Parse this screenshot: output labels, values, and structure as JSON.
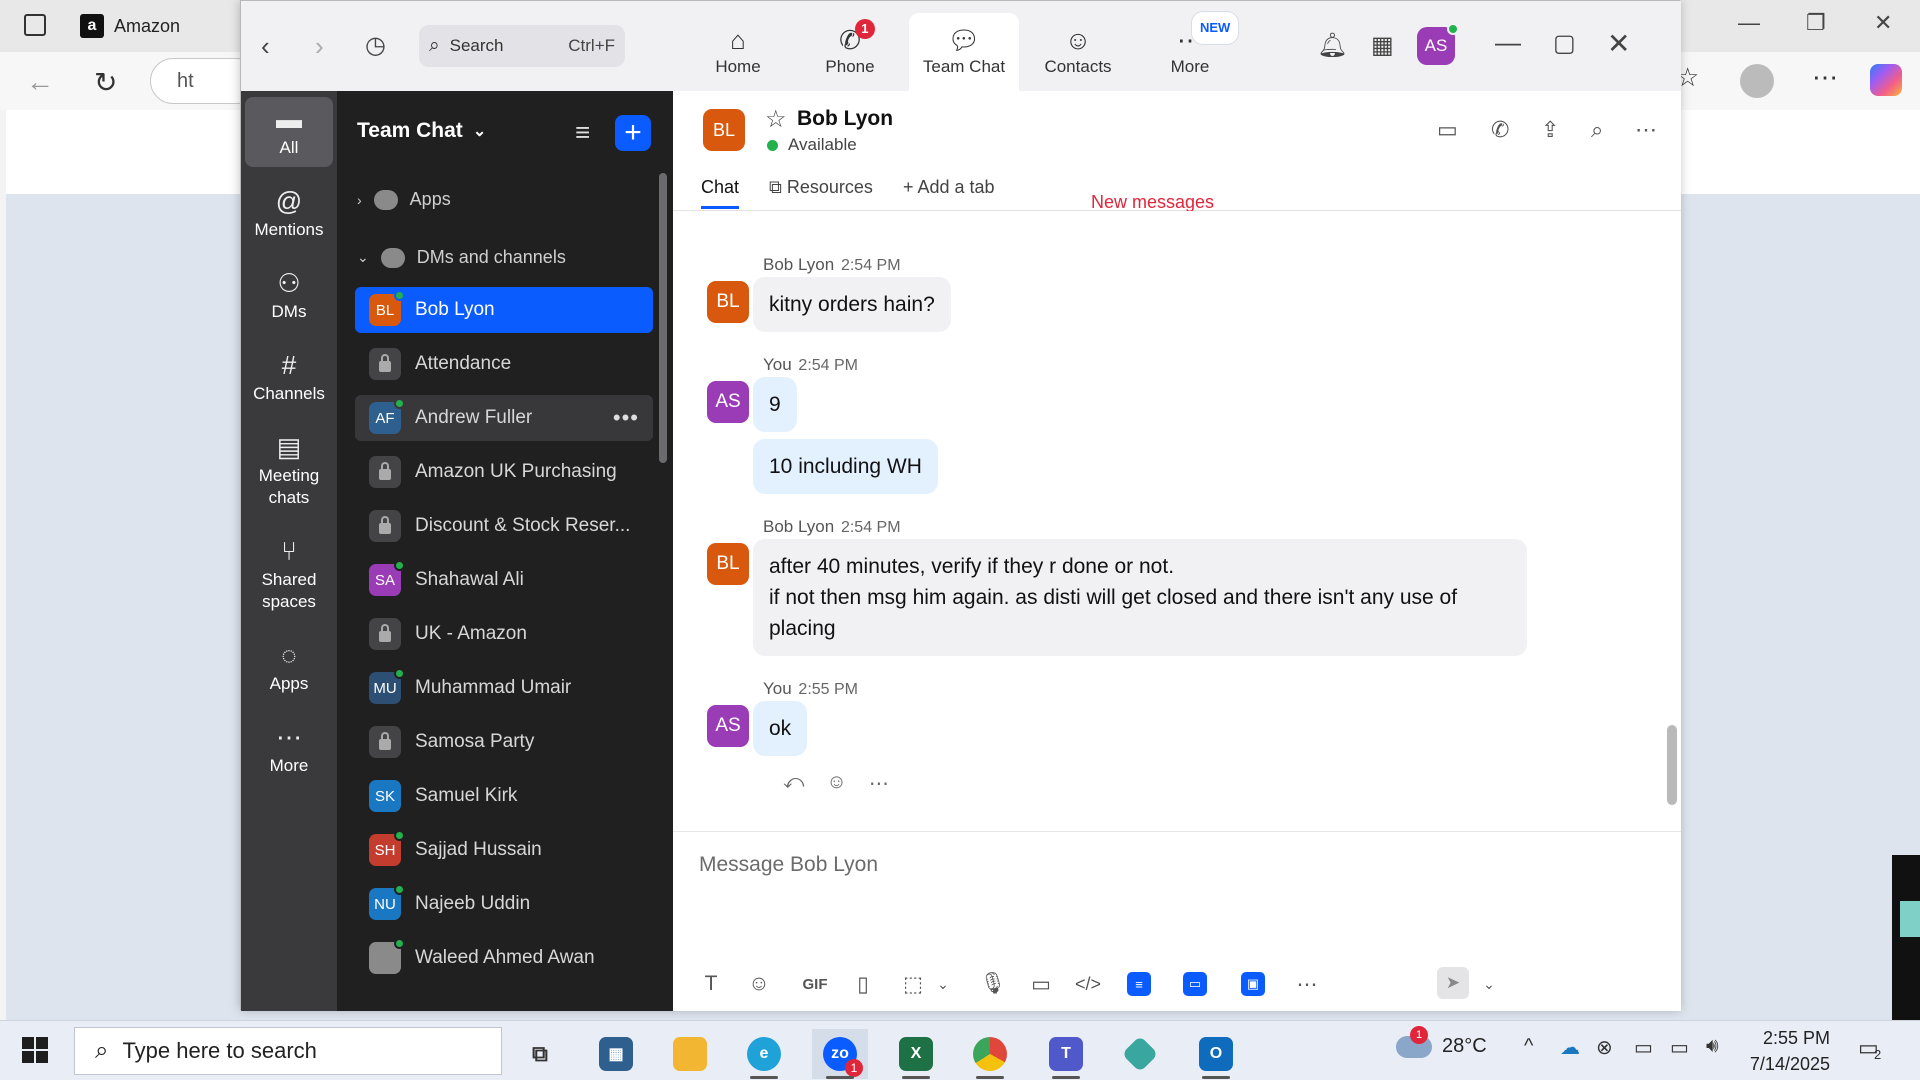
{
  "browser": {
    "tab_title": "Amazon",
    "tab_favicon": "a",
    "url_partial": "ht"
  },
  "zoom": {
    "search": {
      "placeholder": "Search",
      "shortcut": "Ctrl+F"
    },
    "nav_tabs": [
      {
        "label": "Home",
        "icon": "home-icon"
      },
      {
        "label": "Phone",
        "icon": "phone-icon",
        "badge": "1"
      },
      {
        "label": "Team Chat",
        "icon": "chat-icon"
      },
      {
        "label": "Contacts",
        "icon": "contacts-icon"
      },
      {
        "label": "More",
        "icon": "more-icon",
        "badge": "NEW"
      }
    ],
    "user_initials": "AS",
    "rail": [
      {
        "label": "All",
        "icon": "chat-bubble-icon"
      },
      {
        "label": "Mentions",
        "icon": "at-icon"
      },
      {
        "label": "DMs",
        "icon": "people-icon"
      },
      {
        "label": "Channels",
        "icon": "hash-icon"
      },
      {
        "label": "Meeting chats",
        "icon": "calendar-icon"
      },
      {
        "label": "Shared spaces",
        "icon": "share-icon"
      },
      {
        "label": "Apps",
        "icon": "apps-icon"
      },
      {
        "label": "More",
        "icon": "ellipsis-icon"
      }
    ],
    "channel_list": {
      "title": "Team Chat",
      "sections": {
        "apps": "Apps",
        "dms": "DMs and channels"
      },
      "items": [
        {
          "label": "Bob Lyon",
          "initials": "BL",
          "color": "#d8590d",
          "online": true
        },
        {
          "label": "Attendance",
          "locked": true
        },
        {
          "label": "Andrew Fuller",
          "initials": "AF",
          "color": "#2d5f8f",
          "online": true
        },
        {
          "label": "Amazon UK Purchasing",
          "locked": true
        },
        {
          "label": "Discount & Stock Reser...",
          "locked": true
        },
        {
          "label": "Shahawal Ali",
          "initials": "SA",
          "color": "#9b3cb7",
          "online": true
        },
        {
          "label": "UK - Amazon",
          "locked": true
        },
        {
          "label": "Muhammad Umair",
          "initials": "MU",
          "color": "#2d4f73",
          "online": true
        },
        {
          "label": "Samosa Party",
          "locked": true
        },
        {
          "label": "Samuel Kirk",
          "initials": "SK",
          "color": "#1a78c2",
          "online": false
        },
        {
          "label": "Sajjad Hussain",
          "initials": "SH",
          "color": "#c43c2e",
          "online": true
        },
        {
          "label": "Najeeb Uddin",
          "initials": "NU",
          "color": "#1a78c2",
          "online": true
        },
        {
          "label": "Waleed Ahmed Awan",
          "initials": "",
          "color": "#8a8a8a",
          "online": true
        }
      ]
    },
    "chat": {
      "name": "Bob Lyon",
      "initials": "BL",
      "status": "Available",
      "tabs": [
        "Chat",
        "Resources",
        "Add a tab"
      ],
      "new_messages_label": "New messages",
      "messages": [
        {
          "sender": "Bob Lyon",
          "time": "2:54 PM",
          "initials": "BL",
          "lines": [
            "kitny orders hain?"
          ]
        },
        {
          "sender": "You",
          "time": "2:54 PM",
          "initials": "AS",
          "lines": [
            "9",
            "10 including WH"
          ]
        },
        {
          "sender": "Bob Lyon",
          "time": "2:54 PM",
          "initials": "BL",
          "lines": [
            "after 40 minutes, verify if they r done or not.",
            "if not then msg him again. as disti will get closed and there isn't any use of placing"
          ]
        },
        {
          "sender": "You",
          "time": "2:55 PM",
          "initials": "AS",
          "lines": [
            "ok"
          ]
        }
      ],
      "composer_placeholder": "Message Bob Lyon",
      "composer_gif": "GIF"
    }
  },
  "taskbar": {
    "search_placeholder": "Type here to search",
    "weather": "28°C",
    "weather_badge": "1",
    "time": "2:55 PM",
    "date": "7/14/2025",
    "notifications": "2",
    "zoom_badge": "1"
  },
  "colors": {
    "zoom_blue": "#0b5cff",
    "online_green": "#22b14c",
    "alert_red": "#e0263a"
  }
}
